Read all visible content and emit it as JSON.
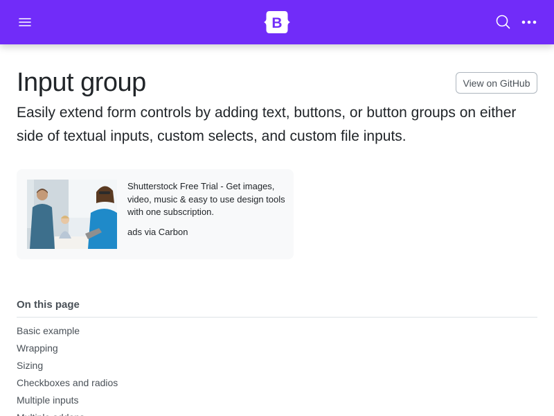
{
  "navbar": {
    "brand_letter": "B",
    "brand_color": "#712cf9",
    "icons": [
      "hamburger-menu-icon",
      "bootstrap-logo-icon",
      "search-icon",
      "more-horizontal-icon"
    ]
  },
  "header": {
    "title": "Input group",
    "github_label": "View on GitHub",
    "lead": "Easily extend form controls by adding text, buttons, or button groups on either side of textual inputs, custom selects, and custom file inputs."
  },
  "ad": {
    "text": "Shutterstock Free Trial - Get images, video, music & easy to use design tools with one subscription.",
    "powered_by": "ads via Carbon"
  },
  "toc": {
    "title": "On this page",
    "items": [
      {
        "label": "Basic example"
      },
      {
        "label": "Wrapping"
      },
      {
        "label": "Sizing"
      },
      {
        "label": "Checkboxes and radios"
      },
      {
        "label": "Multiple inputs"
      },
      {
        "label": "Multiple addons"
      }
    ]
  }
}
